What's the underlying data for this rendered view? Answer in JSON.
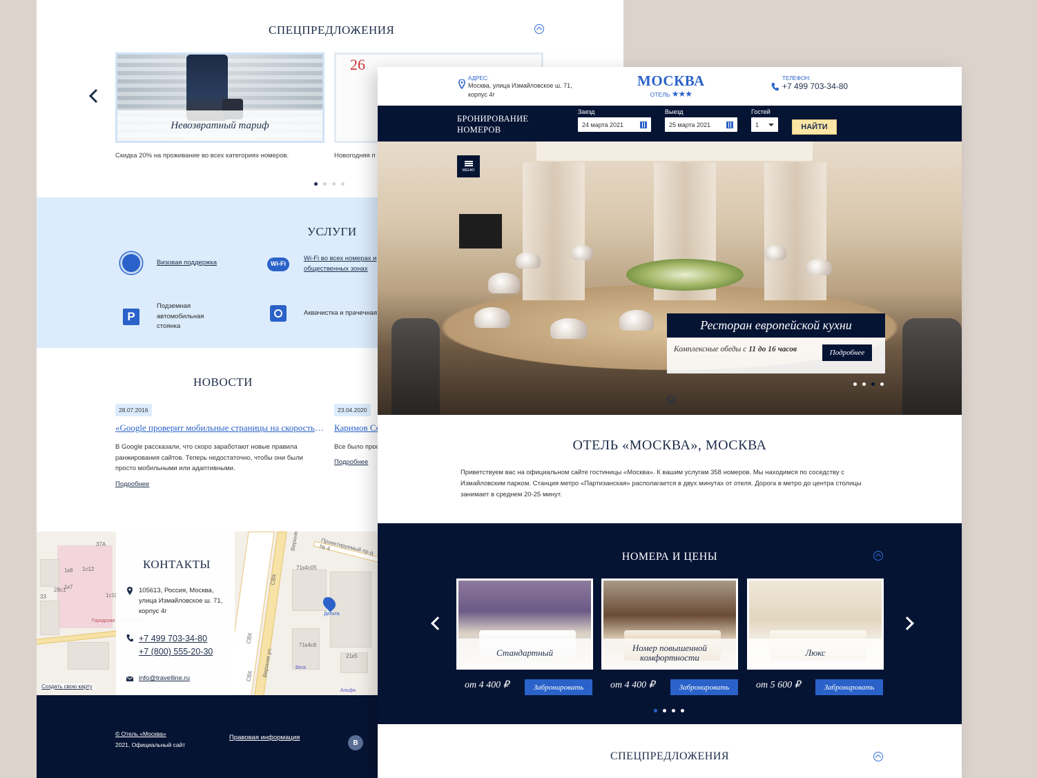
{
  "back": {
    "offers": {
      "title": "СПЕЦПРЕДЛОЖЕНИЯ",
      "cards": [
        {
          "label": "Невозвратный тариф",
          "desc": "Скидка 20% на проживание во всех категориях номеров."
        },
        {
          "label": "",
          "desc": "Новогодняя п"
        }
      ],
      "calendar_number": "26"
    },
    "services": {
      "title": "УСЛУГИ",
      "items": [
        {
          "label": "Визовая поддержка",
          "icon": "emblem-icon"
        },
        {
          "label": "Wi-Fi во всех номерах и общественных зонах",
          "icon": "wifi-icon",
          "badge": "Wi-Fi"
        },
        {
          "label": "Подземная автомобильная стоянка",
          "icon": "parking-icon",
          "badge": "P"
        },
        {
          "label": "Аквачистка и прачечная",
          "icon": "laundry-icon"
        }
      ]
    },
    "news": {
      "title": "НОВОСТИ",
      "items": [
        {
          "date": "28.07.2016",
          "headline": "«Google проверит мобильные страницы на скорость загрузки»",
          "body": "В Google рассказали, что скоро заработают новые правила ранжирования сайтов. Теперь недостаточно, чтобы они были просто мобильными или адаптивными.",
          "more": "Подробнее"
        },
        {
          "date": "23.04.2020",
          "headline": "Каримов Се",
          "body": "Все было прос",
          "more": "Подробнее"
        }
      ]
    },
    "contacts": {
      "title": "КОНТАКТЫ",
      "address": "105613, Россия, Москва, улица Измайловское ш. 71, корпус 4г",
      "phones": [
        "+7 499 703-34-80",
        "+7 (800) 555-20-30"
      ],
      "email": "info@travelline.ru",
      "map_create": "Создать свою карту",
      "map_labels": [
        "Проектируемый пр-д № 4",
        "Верхняя",
        "СВХ",
        "СВХ",
        "СВХ",
        "Верхняя ул.",
        "71к4с05",
        "71к4с6",
        "21к5",
        "Городская больница №",
        "Дельта",
        "Вега",
        "Альфа",
        "37А",
        "1к8",
        "1к7",
        "1с12",
        "1с10",
        "28с1",
        "33"
      ]
    },
    "footer": {
      "copyright": "© Отель «Москва»",
      "year_note": "2021, Официальный сайт",
      "legal": "Правовая информация",
      "vk": "В"
    }
  },
  "front": {
    "header": {
      "address_label": "АДРЕС:",
      "address": "Москва, улица Измайловское ш. 71, корпус 4г",
      "logo": "МОСКВА",
      "logo_sub": "ОТЕЛЬ",
      "stars": "★★★",
      "phone_label": "ТЕЛЕФОН:",
      "phone": "+7 499 703-34-80"
    },
    "booking": {
      "title_line1": "БРОНИРОВАНИЕ",
      "title_line2": "НОМЕРОВ",
      "checkin_label": "Заезд",
      "checkin": "24 марта 2021",
      "checkout_label": "Выезд",
      "checkout": "25 марта 2021",
      "guests_label": "Гостей",
      "guests": "1",
      "submit": "НАЙТИ"
    },
    "hero": {
      "menu": "МЕНЮ",
      "title": "Ресторан европейской кухни",
      "text_prefix": "Комплексные обеды с ",
      "text_bold": "11 до 16 часов",
      "more": "Подробнее"
    },
    "intro": {
      "title": "ОТЕЛЬ «МОСКВА», МОСКВА",
      "text": "Приветствуем вас на официальном сайте гостиницы «Москва». К вашим услугам 358 номеров. Мы находимся по соседству с Измайловским парком. Станция метро «Партизанская» располагается в двух минутах от отеля. Дорога в метро до центра столицы занимает в среднем 20-25 минут."
    },
    "rooms": {
      "title": "НОМЕРА И ЦЕНЫ",
      "items": [
        {
          "name": "Стандартный",
          "price": "от 4 400 ₽",
          "book": "Забронировать"
        },
        {
          "name": "Номер повышенной комфортности",
          "price": "от 4 400 ₽",
          "book": "Забронировать"
        },
        {
          "name": "Люкс",
          "price": "от 5 600 ₽",
          "book": "Забронировать"
        }
      ]
    },
    "offers_title": "СПЕЦПРЕДЛОЖЕНИЯ"
  }
}
